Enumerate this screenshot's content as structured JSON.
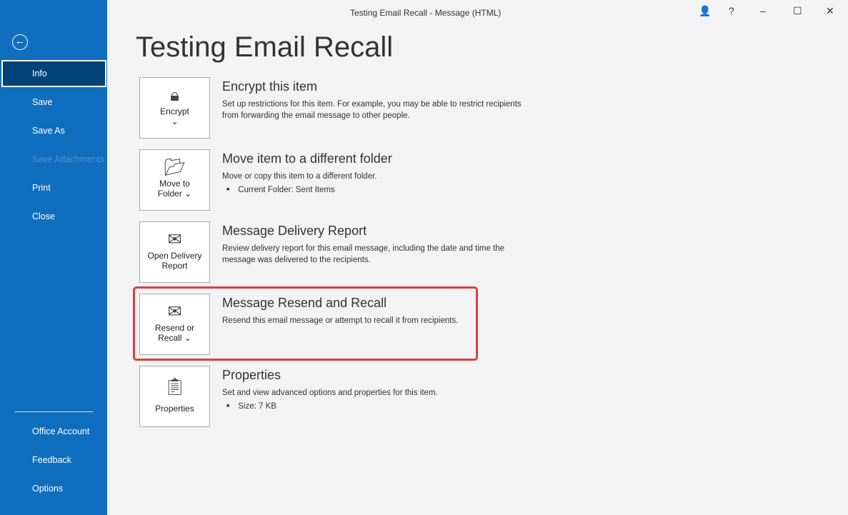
{
  "window": {
    "title": "Testing Email Recall  -  Message (HTML)",
    "controls": [
      "?",
      "–",
      "☐",
      "✕"
    ]
  },
  "sidebar": {
    "items": [
      {
        "label": "Info",
        "active": true
      },
      {
        "label": "Save"
      },
      {
        "label": "Save As"
      },
      {
        "label": "Save Attachments",
        "disabled": true
      },
      {
        "label": "Print"
      },
      {
        "label": "Close"
      }
    ],
    "bottom": [
      {
        "label": "Office Account"
      },
      {
        "label": "Feedback"
      },
      {
        "label": "Options"
      }
    ]
  },
  "page_title": "Testing Email Recall",
  "sections": [
    {
      "button": "Encrypt",
      "button2": "⌄",
      "title": "Encrypt this item",
      "desc": "Set up restrictions for this item. For example, you may be able to restrict recipients from forwarding the email message to other people."
    },
    {
      "button": "Move to",
      "button2": "Folder ⌄",
      "title": "Move item to a different folder",
      "desc": "Move or copy this item to a different folder.",
      "bullet": "Current Folder:   Sent Items"
    },
    {
      "button": "Open Delivery",
      "button2": "Report",
      "title": "Message Delivery Report",
      "desc": "Review delivery report for this email message, including the date and time the message was delivered to the recipients."
    },
    {
      "button": "Resend or",
      "button2": "Recall ⌄",
      "title": "Message Resend and Recall",
      "desc": "Resend this email message or attempt to recall it from recipients."
    },
    {
      "button": "Properties",
      "button2": "",
      "title": "Properties",
      "desc": "Set and view advanced options and properties for this item.",
      "bullet": "Size:   7 KB"
    }
  ],
  "highlight_color": "#d9403a"
}
